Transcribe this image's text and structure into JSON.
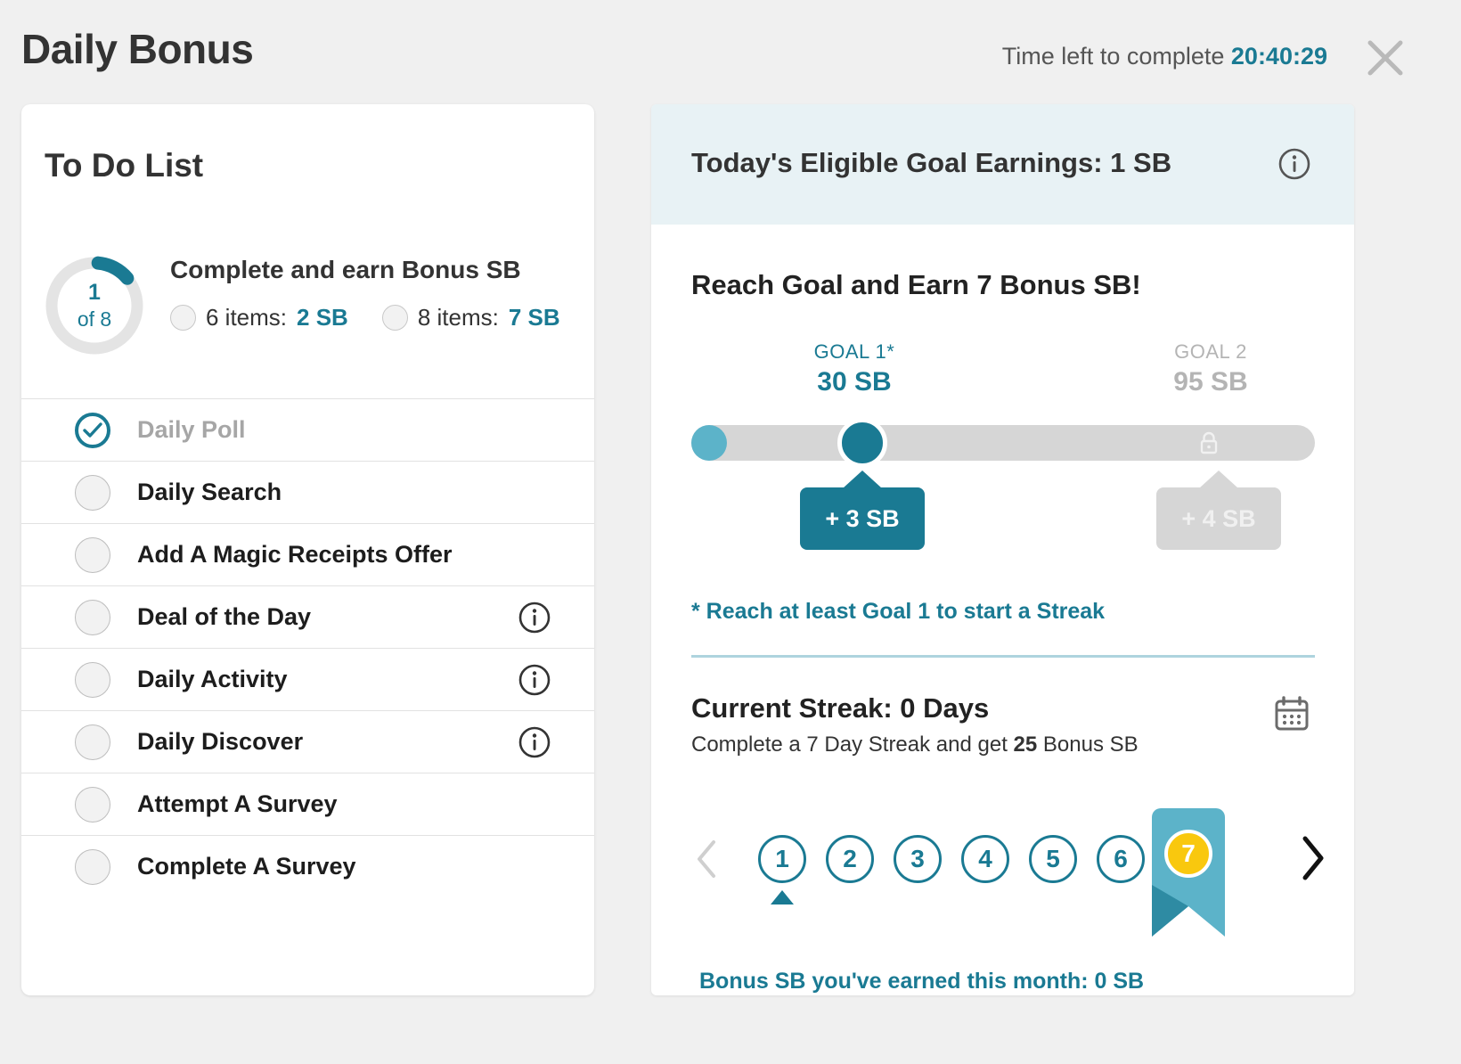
{
  "header": {
    "title": "Daily Bonus",
    "timer_label": "Time left to complete",
    "timer_value": "20:40:29",
    "close_icon": "close-icon"
  },
  "todo": {
    "title": "To Do List",
    "progress": {
      "completed": "1",
      "of_label": "of 8",
      "completed_count": 1,
      "total_count": 8
    },
    "earn_title": "Complete and earn Bonus SB",
    "tiers": [
      {
        "label": "6 items:",
        "reward": "2 SB",
        "achieved": false
      },
      {
        "label": "8 items:",
        "reward": "7 SB",
        "achieved": false
      }
    ],
    "items": [
      {
        "label": "Daily Poll",
        "done": true,
        "info": false
      },
      {
        "label": "Daily Search",
        "done": false,
        "info": false
      },
      {
        "label": "Add A Magic Receipts Offer",
        "done": false,
        "info": false
      },
      {
        "label": "Deal of the Day",
        "done": false,
        "info": true
      },
      {
        "label": "Daily Activity",
        "done": false,
        "info": true
      },
      {
        "label": "Daily Discover",
        "done": false,
        "info": true
      },
      {
        "label": "Attempt A Survey",
        "done": false,
        "info": false
      },
      {
        "label": "Complete A Survey",
        "done": false,
        "info": false
      }
    ]
  },
  "goals": {
    "banner_title": "Today's Eligible Goal Earnings: 1 SB",
    "banner_info_icon": "info-icon",
    "reach_title": "Reach Goal and Earn 7 Bonus SB!",
    "goal1": {
      "name": "GOAL 1*",
      "value": "30 SB",
      "bonus": "+ 3 SB",
      "locked": false
    },
    "goal2": {
      "name": "GOAL 2",
      "value": "95 SB",
      "bonus": "+ 4 SB",
      "locked": true
    },
    "lock_icon": "lock-icon",
    "note": "* Reach at least Goal 1 to start a Streak"
  },
  "streak": {
    "title": "Current Streak: 0 Days",
    "sub_prefix": "Complete a 7 Day Streak and get ",
    "sub_bonus": "25",
    "sub_suffix": " Bonus SB",
    "calendar_icon": "calendar-icon",
    "prev_icon": "chevron-left-icon",
    "next_icon": "chevron-right-icon",
    "days": [
      "1",
      "2",
      "3",
      "4",
      "5",
      "6"
    ],
    "current_day_marker": "1",
    "reward_day": "7",
    "month_total": "Bonus SB you've earned this month:  0 SB"
  },
  "colors": {
    "accent": "#1a7a93",
    "accent_light": "#5cb3c9",
    "gold": "#f9c80e",
    "track": "#d6d6d6",
    "banner_bg": "#e8f2f5"
  }
}
